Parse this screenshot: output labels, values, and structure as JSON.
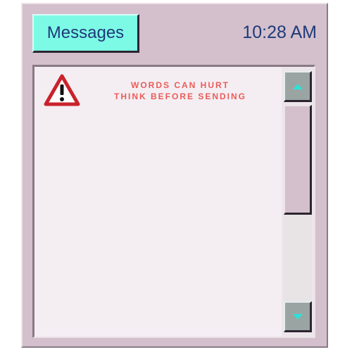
{
  "header": {
    "messages_label": "Messages",
    "time": "10:28 AM"
  },
  "warning": {
    "line1": "WORDS CAN HURT",
    "line2": "THINK BEFORE SENDING",
    "icon": "warning-triangle-icon",
    "color": "#ec5b57"
  },
  "scrollbar": {
    "up_icon": "arrow-up-icon",
    "down_icon": "arrow-down-icon"
  },
  "colors": {
    "window": "#d3c0cc",
    "button_accent": "#7dfae6",
    "text": "#1f3a7a",
    "panel": "#f4eef3"
  }
}
